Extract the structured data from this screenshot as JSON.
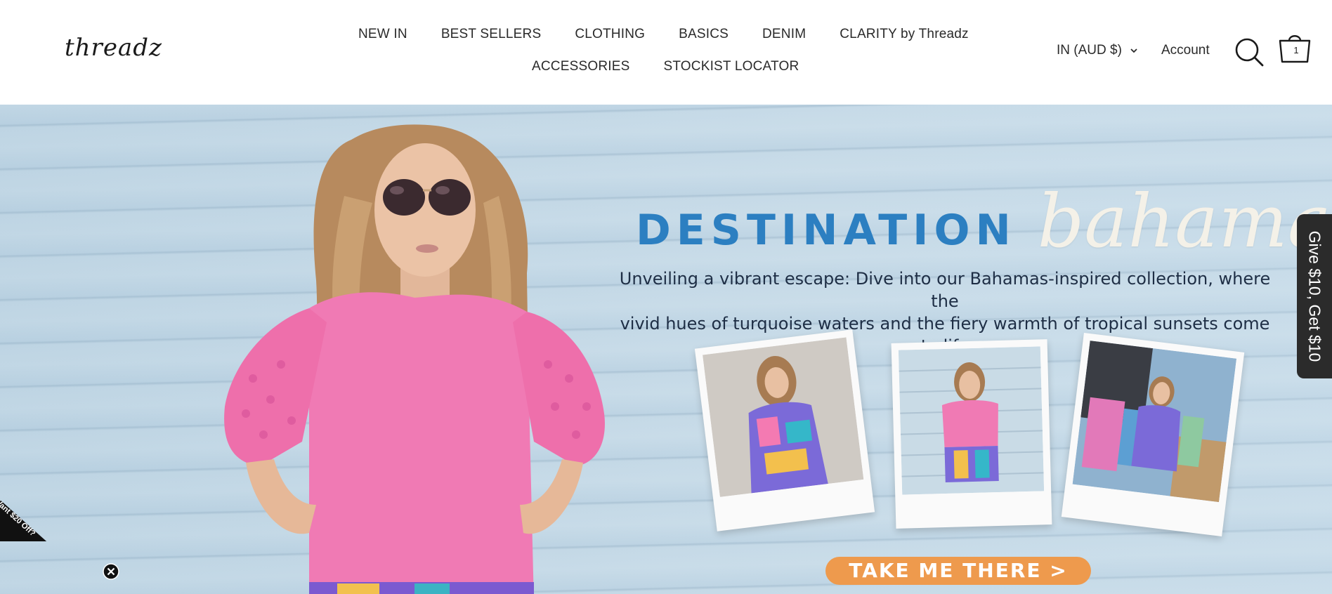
{
  "header": {
    "logo": "threadz",
    "nav_row1": [
      "NEW IN",
      "BEST SELLERS",
      "CLOTHING",
      "BASICS",
      "DENIM",
      "CLARITY by Threadz"
    ],
    "nav_row2": [
      "ACCESSORIES",
      "STOCKIST LOCATOR"
    ],
    "currency": "IN (AUD $)",
    "account": "Account",
    "cart_count": "1"
  },
  "hero": {
    "headline_1": "DESTINATION",
    "headline_2": "bahamas",
    "subtitle_line1": "Unveiling a vibrant escape: Dive into our Bahamas-inspired collection, where the",
    "subtitle_line2": "vivid hues of turquoise waters and the fiery warmth of tropical sunsets come to life",
    "cta": "TAKE ME THERE >"
  },
  "side_tab": "Give $10, Get $10",
  "offer": "Want $20 Off?",
  "colors": {
    "headline_blue": "#2c7fc1",
    "cta_orange": "#ee9a4d",
    "top_pink": "#f07ab4",
    "siding": "#c7dbe8"
  }
}
